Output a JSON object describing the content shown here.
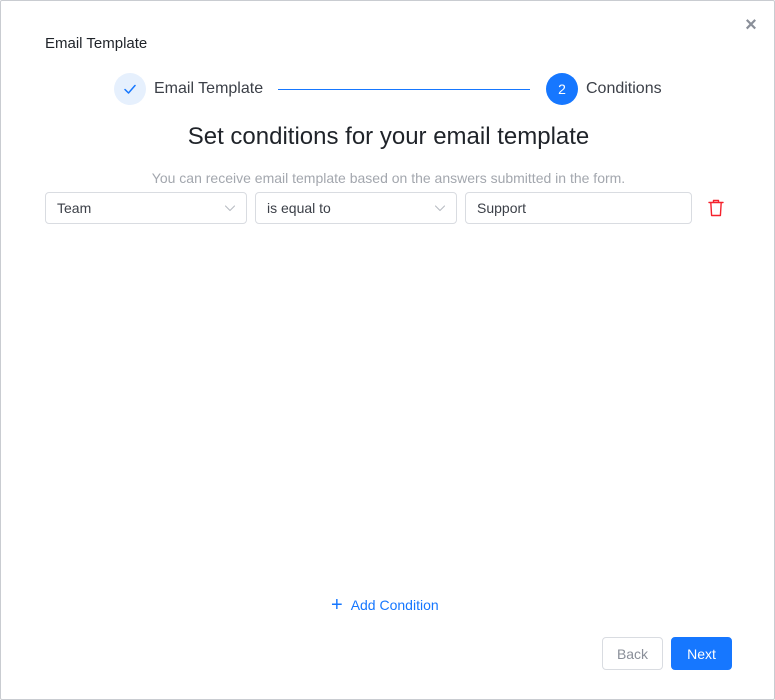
{
  "dialog": {
    "title": "Email Template",
    "close_symbol": "×"
  },
  "steps": [
    {
      "label": "Email Template",
      "status": "completed",
      "icon": "check-icon"
    },
    {
      "label": "Conditions",
      "status": "active",
      "number": "2"
    }
  ],
  "main": {
    "heading": "Set conditions for your email template",
    "subtitle": "You can receive email template based on the answers submitted in the form."
  },
  "conditions": [
    {
      "field": "Team",
      "operator": "is equal to",
      "value": "Support"
    }
  ],
  "actions": {
    "add_condition": "Add Condition",
    "back": "Back",
    "next": "Next"
  },
  "colors": {
    "primary": "#1677ff",
    "step_done_bg": "#e6f0fd",
    "danger": "#f5222d",
    "muted_text": "#a3a7ae"
  }
}
